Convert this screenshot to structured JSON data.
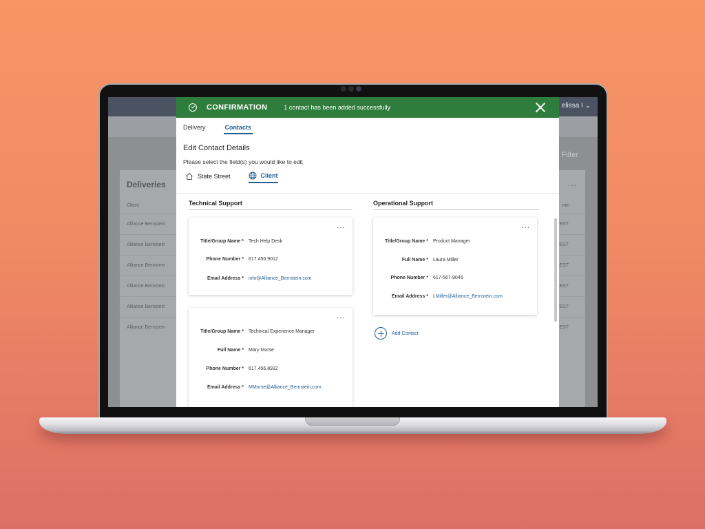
{
  "background_app": {
    "user_label": "elissa I",
    "filter_label": "Filter",
    "panel_title": "Deliveries",
    "more_label": "...",
    "column_client": "Client",
    "column_right": "me",
    "rows": [
      {
        "client": "Alliance Bernstein",
        "right": "EST"
      },
      {
        "client": "Alliance Bernstein",
        "right": "EST"
      },
      {
        "client": "Alliance Bernstein",
        "right": "EST"
      },
      {
        "client": "Alliance Bernstein",
        "right": "EST"
      },
      {
        "client": "Alliance Bernstein",
        "right": "EST"
      },
      {
        "client": "Alliance Bernstein",
        "right": "EST"
      }
    ]
  },
  "banner": {
    "title": "CONFIRMATION",
    "message": "1 contact has been added successfully",
    "color": "#2f7d3d"
  },
  "tabs": [
    {
      "label": "Delivery",
      "active": false
    },
    {
      "label": "Contacts",
      "active": true
    }
  ],
  "heading": "Edit Contact Details",
  "subheading": "Please select the field(s) you would like to edit",
  "selectors": [
    {
      "label": "State Street",
      "icon": "house-icon",
      "active": false
    },
    {
      "label": "Client",
      "icon": "globe-icon",
      "active": true
    }
  ],
  "technical_support": {
    "title": "Technical Support",
    "cards": [
      {
        "more": "...",
        "fields": [
          {
            "label": "Title/Group Name *",
            "value": "Tech Help Desk"
          },
          {
            "label": "Phone Number *",
            "value": "617.456.9012"
          },
          {
            "label": "Email Address *",
            "value": "info@Alliance_Bernstein.com"
          }
        ]
      },
      {
        "more": "...",
        "fields": [
          {
            "label": "Title/Group Name *",
            "value": "Technical Experience Manager"
          },
          {
            "label": "Full Name *",
            "value": "Mary Morse"
          },
          {
            "label": "Phone Number *",
            "value": "617.456.8932"
          },
          {
            "label": "Email Address *",
            "value": "MMorse@Alliance_Bernstein.com"
          }
        ]
      }
    ]
  },
  "operational_support": {
    "title": "Operational Support",
    "cards": [
      {
        "more": "...",
        "fields": [
          {
            "label": "Title/Group Name *",
            "value": "Product Manager"
          },
          {
            "label": "Full Name *",
            "value": "Laura Miller"
          },
          {
            "label": "Phone Number *",
            "value": "617-567-9045"
          },
          {
            "label": "Email Address *",
            "value": "LMiller@Alliance_Bernstein.com"
          }
        ]
      }
    ],
    "add_contact_label": "Add Contact"
  },
  "accent_color": "#1f5d93"
}
